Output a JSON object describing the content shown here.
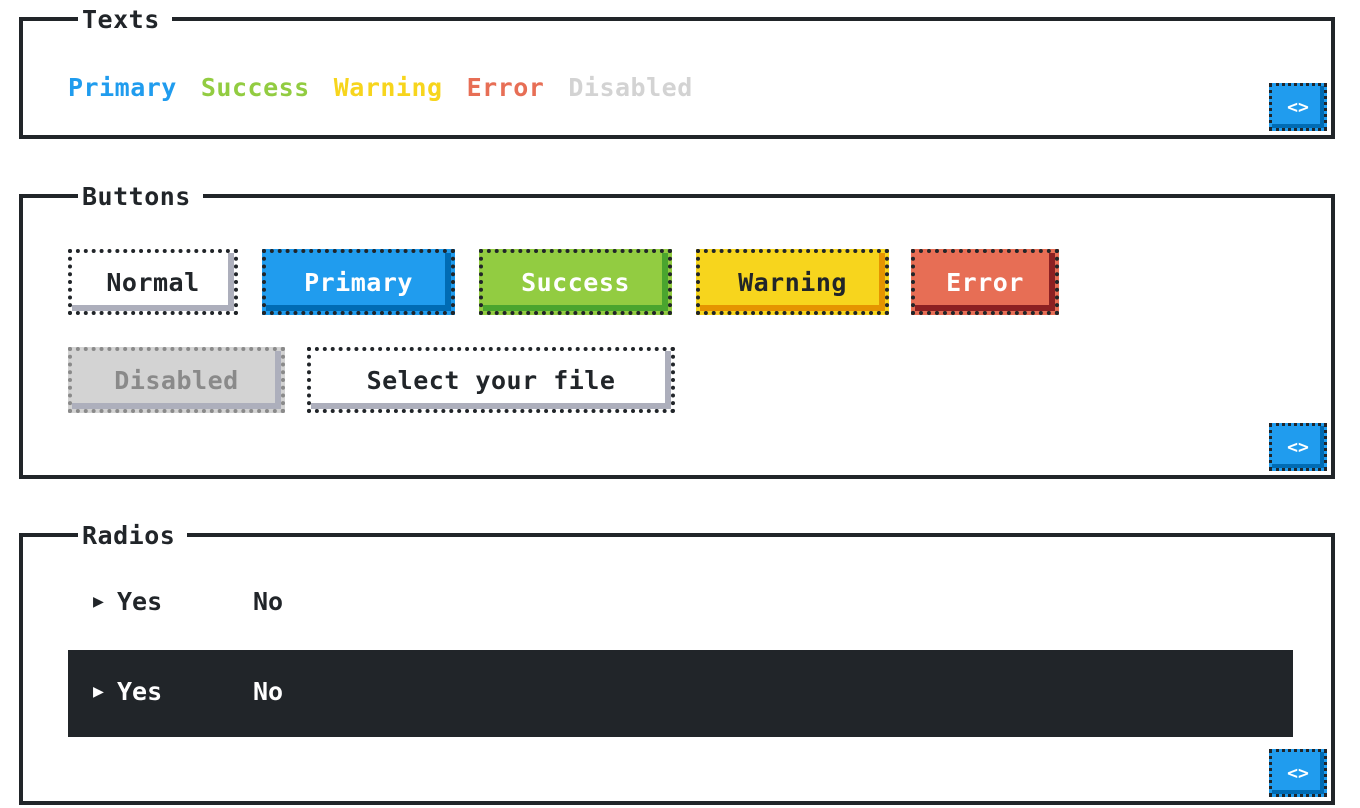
{
  "texts_panel": {
    "title": "Texts",
    "items": [
      {
        "label": "Primary",
        "color": "#209cee"
      },
      {
        "label": "Success",
        "color": "#92cc41"
      },
      {
        "label": "Warning",
        "color": "#f7d51d"
      },
      {
        "label": "Error",
        "color": "#e76e55"
      },
      {
        "label": "Disabled",
        "color": "#d3d3d3"
      }
    ],
    "code_label": "<>"
  },
  "buttons_panel": {
    "title": "Buttons",
    "normal": "Normal",
    "primary": "Primary",
    "success": "Success",
    "warning": "Warning",
    "error": "Error",
    "disabled": "Disabled",
    "file": "Select your file",
    "code_label": "<>"
  },
  "radios_panel": {
    "title": "Radios",
    "light": {
      "yes": "Yes",
      "no": "No",
      "selected": "Yes"
    },
    "dark": {
      "yes": "Yes",
      "no": "No",
      "selected": "Yes"
    },
    "arrow": "▶",
    "code_label": "<>"
  }
}
